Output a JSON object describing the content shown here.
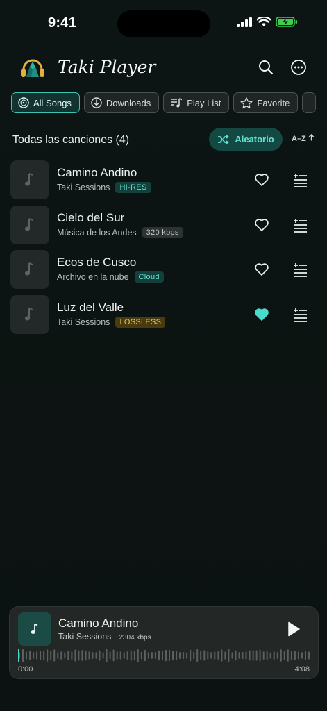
{
  "status_bar": {
    "time": "9:41"
  },
  "header": {
    "app_title": "Taki Player"
  },
  "chips": [
    {
      "label": "All Songs",
      "icon": "disc-icon",
      "active": true
    },
    {
      "label": "Downloads",
      "icon": "download-icon",
      "active": false
    },
    {
      "label": "Play List",
      "icon": "playlist-icon",
      "active": false
    },
    {
      "label": "Favorite",
      "icon": "star-icon",
      "active": false
    }
  ],
  "list_header": {
    "title": "Todas las canciones (4)",
    "shuffle_label": "Aleatorio",
    "sort_label": "A–Z"
  },
  "songs": [
    {
      "title": "Camino Andino",
      "artist": "Taki Sessions",
      "badge": "HI-RES",
      "badge_style": "teal",
      "favorite": false,
      "playing": true
    },
    {
      "title": "Cielo del Sur",
      "artist": "Música de los Andes",
      "badge": "320 kbps",
      "badge_style": "gray",
      "favorite": false,
      "playing": false
    },
    {
      "title": "Ecos de Cusco",
      "artist": "Archivo en la nube",
      "badge": "Cloud",
      "badge_style": "teal",
      "favorite": false,
      "playing": false
    },
    {
      "title": "Luz del Valle",
      "artist": "Taki Sessions",
      "badge": "LOSSLESS",
      "badge_style": "gold",
      "favorite": true,
      "playing": false
    }
  ],
  "player": {
    "title": "Camino Andino",
    "artist": "Taki Sessions",
    "bitrate": "2304 kbps",
    "elapsed": "0:00",
    "duration": "4:08",
    "progress": 0
  },
  "colors": {
    "accent": "#49dccb",
    "background": "#0c1413",
    "favorite": "#49dccb"
  }
}
